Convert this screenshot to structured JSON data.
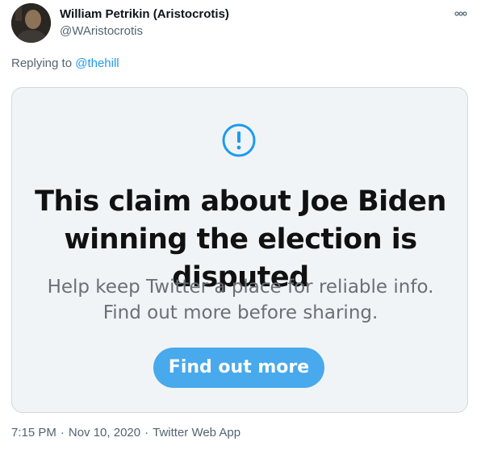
{
  "author": {
    "name": "William Petrikin (Aristocrotis)",
    "handle": "@WAristocrotis"
  },
  "menu": {
    "more_icon": "more-options-icon"
  },
  "reply_context": {
    "prefix": "Replying to ",
    "mention": "@thehill"
  },
  "media": {
    "icon": "exclamation-circle-icon",
    "title_line1": "This claim about Joe Biden",
    "title_line2": "winning the election is disputed",
    "subtitle_line1": "Help keep Twitter a place for reliable info.",
    "subtitle_line2": "Find out more before sharing.",
    "button_label": "Find out more"
  },
  "meta": {
    "time": "7:15 PM",
    "separator": "·",
    "date": "Nov 10, 2020",
    "source": "Twitter Web App"
  },
  "colors": {
    "accent": "#1d9bf0",
    "button": "#48a9ec",
    "muted": "#536471",
    "card_bg": "#f1f4f6"
  }
}
